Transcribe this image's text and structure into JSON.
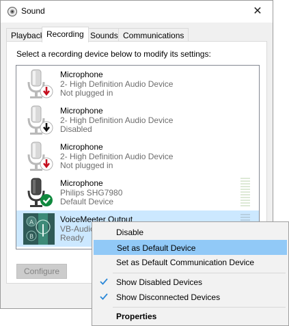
{
  "window": {
    "title": "Sound",
    "close_glyph": "✕"
  },
  "tabs": [
    {
      "label": "Playback"
    },
    {
      "label": "Recording"
    },
    {
      "label": "Sounds"
    },
    {
      "label": "Communications"
    }
  ],
  "panel": {
    "instructions": "Select a recording device below to modify its settings:"
  },
  "devices": [
    {
      "name": "Microphone",
      "description": "2- High Definition Audio Device",
      "status": "Not plugged in",
      "badge": "unplugged-red-arrow"
    },
    {
      "name": "Microphone",
      "description": "2- High Definition Audio Device",
      "status": "Disabled",
      "badge": "disabled-black-arrow"
    },
    {
      "name": "Microphone",
      "description": "2- High Definition Audio Device",
      "status": "Not plugged in",
      "badge": "unplugged-red-arrow"
    },
    {
      "name": "Microphone",
      "description": "Philips SHG7980",
      "status": "Default Device",
      "badge": "default-green-check"
    },
    {
      "name": "VoiceMeeter Output",
      "description": "VB-Audio",
      "status": "Ready",
      "badge": "none"
    }
  ],
  "buttons": {
    "configure": "Configure"
  },
  "context_menu": {
    "items": [
      {
        "label": "Disable",
        "checked": false,
        "bold": false
      },
      {
        "label": "Set as Default Device",
        "checked": false,
        "bold": false
      },
      {
        "label": "Set as Default Communication Device",
        "checked": false,
        "bold": false
      },
      {
        "label": "Show Disabled Devices",
        "checked": true,
        "bold": false
      },
      {
        "label": "Show Disconnected Devices",
        "checked": true,
        "bold": false
      },
      {
        "label": "Properties",
        "checked": false,
        "bold": true
      }
    ]
  },
  "colors": {
    "selection": "#cce8ff",
    "menu_highlight": "#91c9f7",
    "check": "#2b88d8",
    "red_badge": "#c50f1f",
    "green_badge": "#10893e"
  }
}
